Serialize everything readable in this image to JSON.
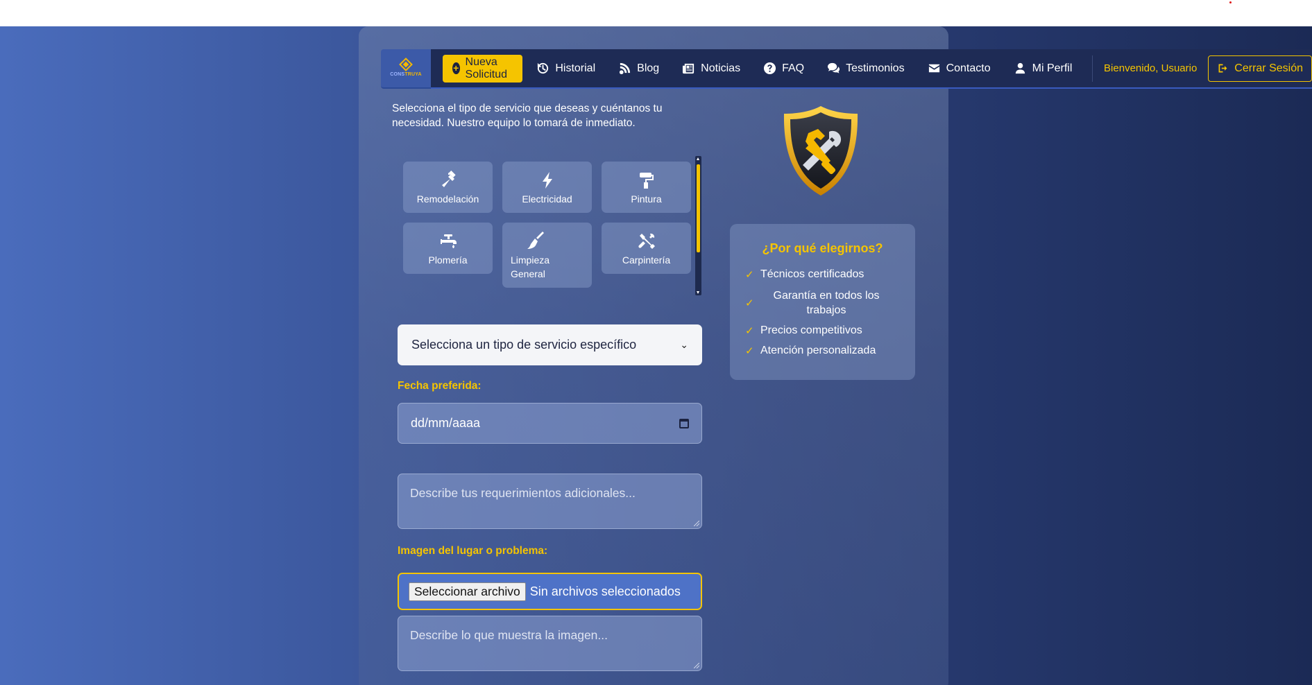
{
  "navbar": {
    "logo_text_a": "CONS",
    "logo_text_b": "TRUYA",
    "new_request": "Nueva Solicitud",
    "items": [
      {
        "label": "Historial",
        "icon": "history-icon"
      },
      {
        "label": "Blog",
        "icon": "blog-icon"
      },
      {
        "label": "Noticias",
        "icon": "newspaper-icon"
      },
      {
        "label": "FAQ",
        "icon": "question-circle-icon"
      },
      {
        "label": "Testimonios",
        "icon": "comments-icon"
      },
      {
        "label": "Contacto",
        "icon": "envelope-icon"
      },
      {
        "label": "Mi Perfil",
        "icon": "user-icon"
      }
    ],
    "welcome": "Bienvenido, Usuario",
    "logout": "Cerrar Sesión"
  },
  "intro": "Selecciona el tipo de servicio que deseas y cuéntanos tu necesidad. Nuestro equipo lo tomará de inmediato.",
  "services": [
    {
      "label": "Remodelación",
      "icon": "hammer-icon"
    },
    {
      "label": "Electricidad",
      "icon": "bolt-icon"
    },
    {
      "label": "Pintura",
      "icon": "paint-roller-icon"
    },
    {
      "label": "Plomería",
      "icon": "faucet-icon"
    },
    {
      "label": "Limpieza General",
      "icon": "broom-icon"
    },
    {
      "label": "Carpintería",
      "icon": "tools-icon"
    }
  ],
  "form": {
    "service_select": "Selecciona un tipo de servicio específico",
    "date_label": "Fecha preferida:",
    "date_placeholder": "dd/mm/aaaa",
    "requirements_placeholder": "Describe tus requerimientos adicionales...",
    "image_label": "Imagen del lugar o problema:",
    "file_button": "Seleccionar archivo",
    "file_status": "Sin archivos seleccionados",
    "image_desc_placeholder": "Describe lo que muestra la imagen..."
  },
  "why": {
    "title": "¿Por qué elegirnos?",
    "items": [
      "Técnicos certificados",
      "Garantía en todos los trabajos",
      "Precios competitivos",
      "Atención personalizada"
    ]
  },
  "colors": {
    "accent": "#f5c400",
    "navbar": "#1e2b55"
  }
}
